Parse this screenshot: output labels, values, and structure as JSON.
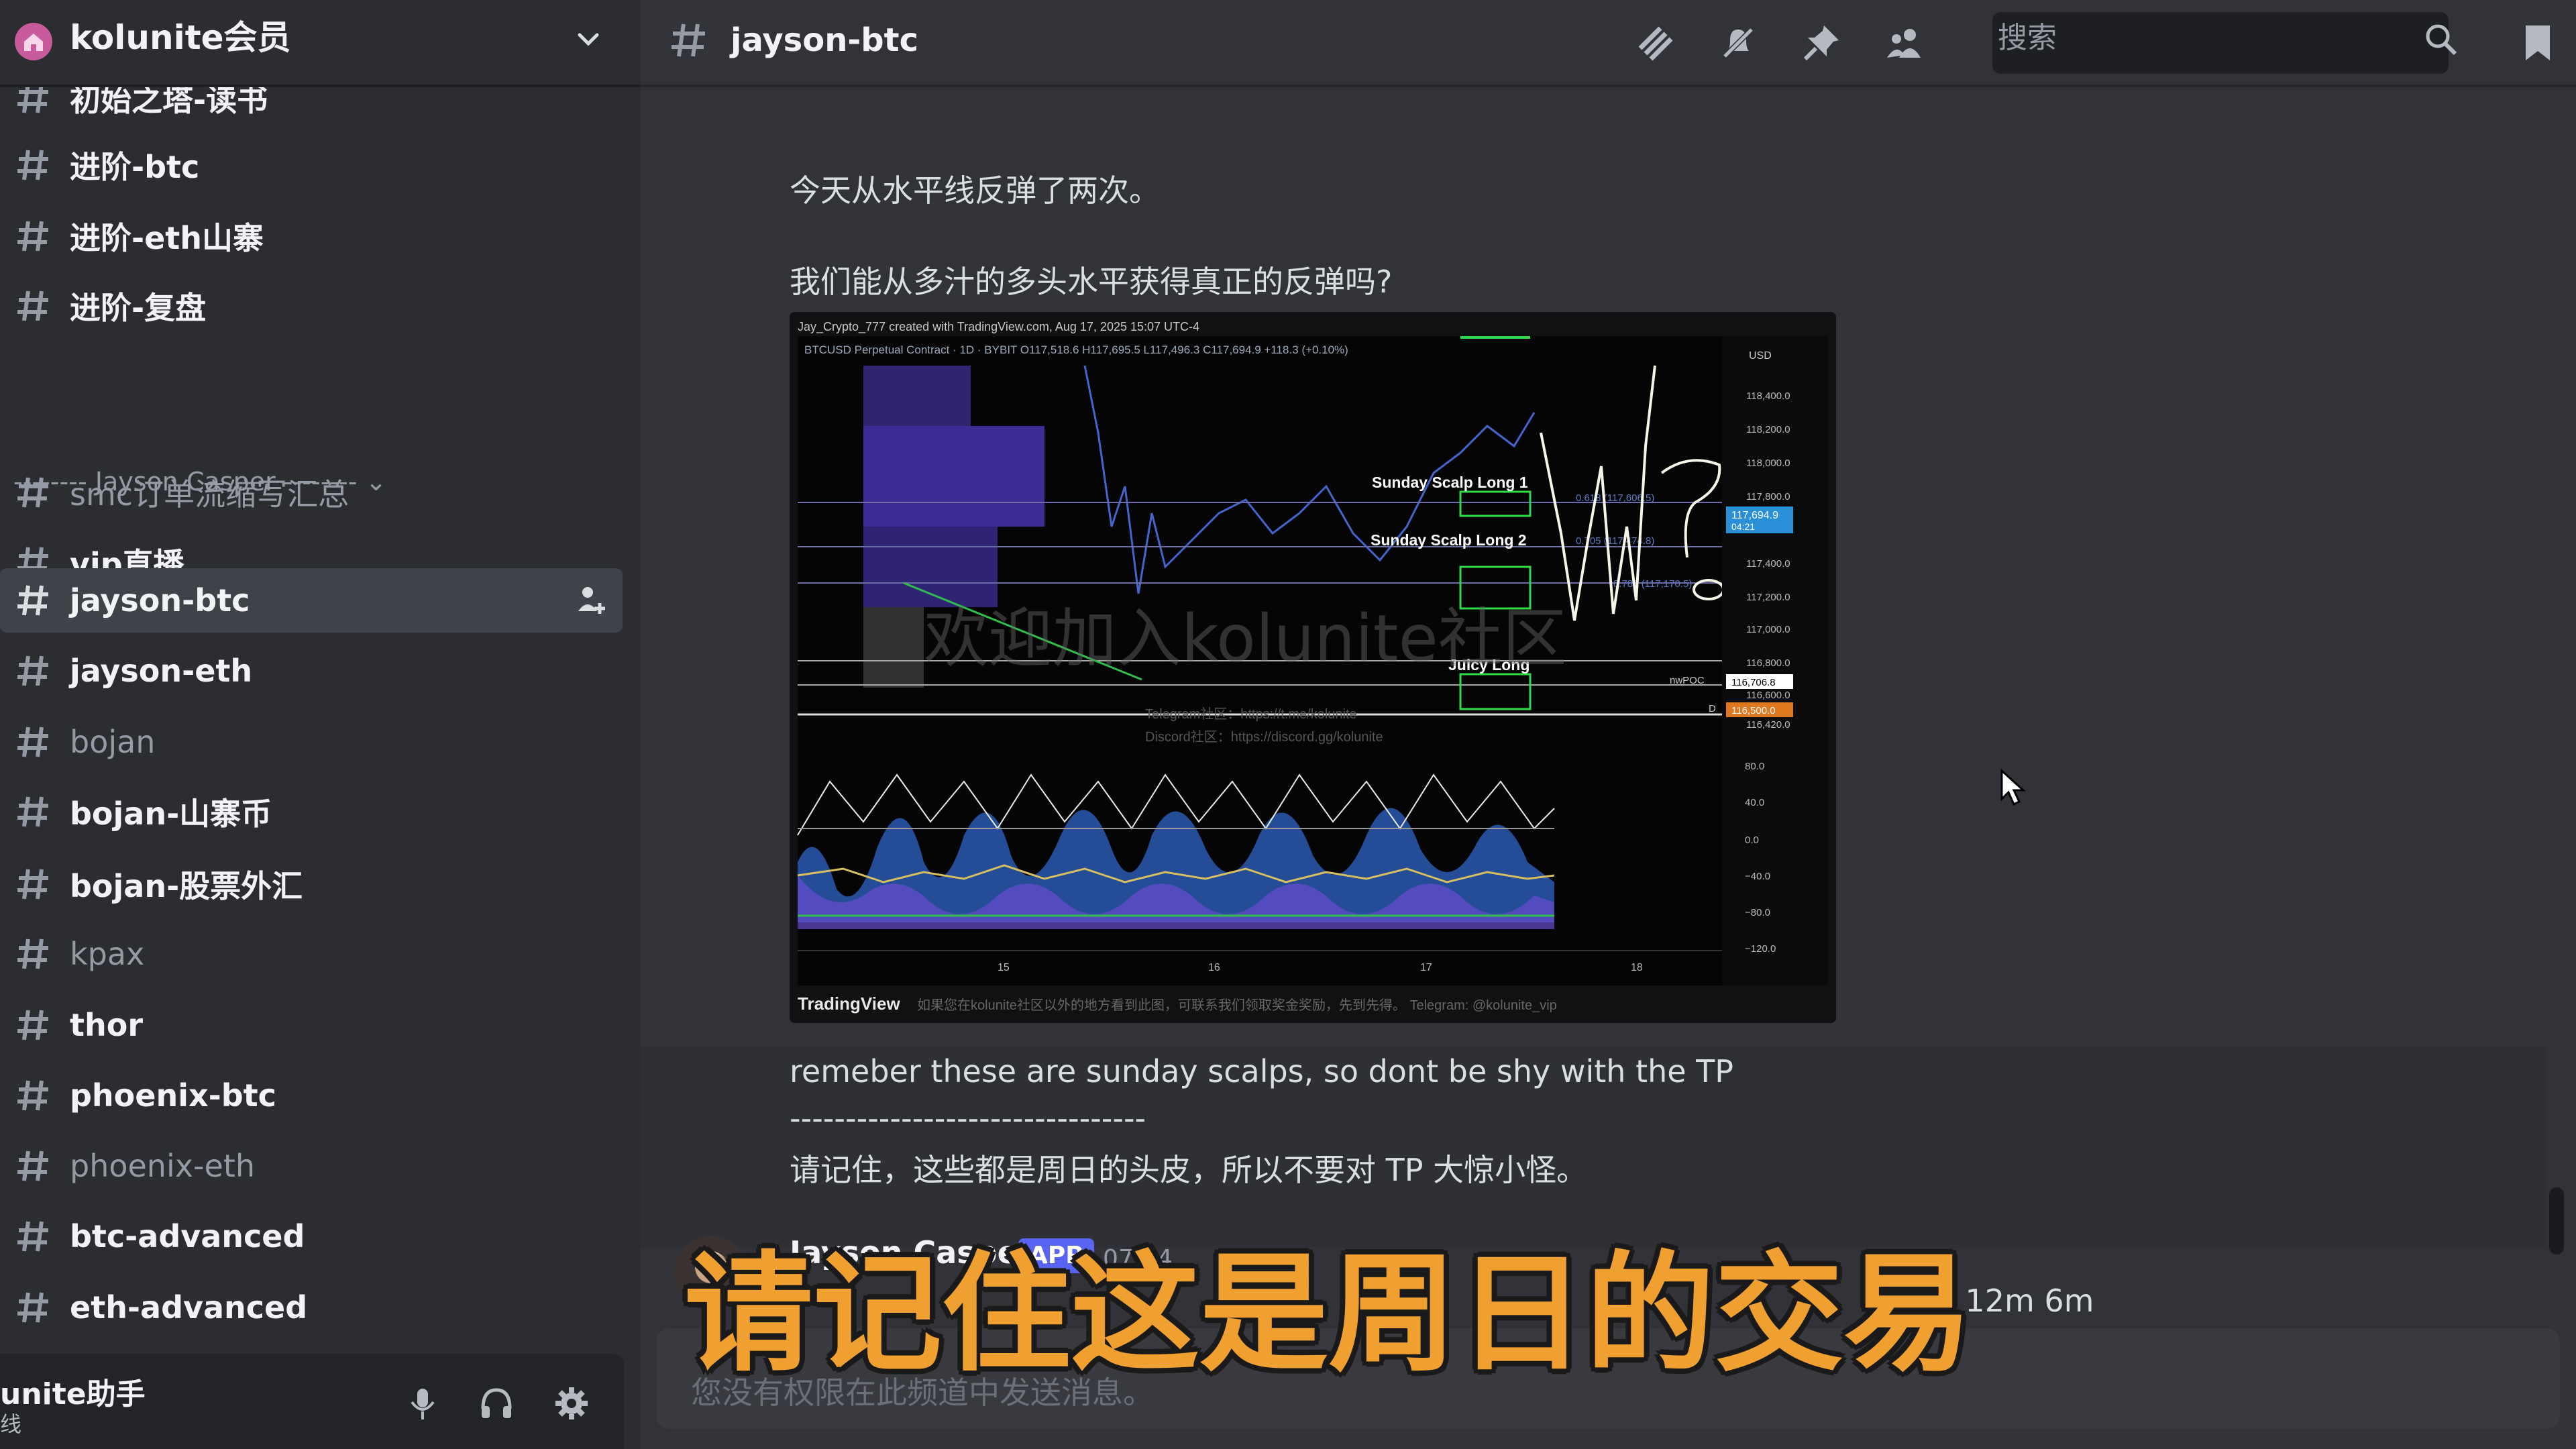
{
  "server": {
    "name": "kolunite会员"
  },
  "sidebar": {
    "channels_top": [
      {
        "label": "初始之塔-读书",
        "muted": false
      },
      {
        "label": "进阶-btc",
        "muted": false
      },
      {
        "label": "进阶-eth山寨",
        "muted": false
      },
      {
        "label": "进阶-复盘",
        "muted": false
      }
    ],
    "category": "-------- Jayson Casper --------",
    "channels": [
      {
        "label": "smc订单流缩写汇总",
        "muted": true
      },
      {
        "label": "vip直播",
        "muted": false
      },
      {
        "label": "jayson-btc",
        "muted": false,
        "active": true
      },
      {
        "label": "jayson-eth",
        "muted": false
      },
      {
        "label": "bojan",
        "muted": true
      },
      {
        "label": "bojan-山寨币",
        "muted": false
      },
      {
        "label": "bojan-股票外汇",
        "muted": false
      },
      {
        "label": "kpax",
        "muted": true
      },
      {
        "label": "thor",
        "muted": false
      },
      {
        "label": "phoenix-btc",
        "muted": false
      },
      {
        "label": "phoenix-eth",
        "muted": true
      },
      {
        "label": "btc-advanced",
        "muted": false
      },
      {
        "label": "eth-advanced",
        "muted": false
      }
    ]
  },
  "user_panel": {
    "name": "unite助手",
    "status": "线"
  },
  "topbar": {
    "channel": "jayson-btc",
    "search_placeholder": "搜索"
  },
  "messages": {
    "line1": "今天从水平线反弹了两次。",
    "line2": "我们能从多汁的多头水平获得真正的反弹吗?",
    "line3": "remeber these are sunday scalps, so dont be shy with the TP",
    "divider": "--------------------------------",
    "line4": "请记住，这些都是周日的头皮，所以不要对 TP 大惊小怪。",
    "author": {
      "name": "Jayson Casper",
      "badge": "APP",
      "time": "07:24",
      "preview": "m 12m 6m"
    }
  },
  "chart": {
    "header": "Jay_Crypto_777 created with TradingView.com, Aug 17, 2025 15:07 UTC-4",
    "symbol": "BTCUSD Perpetual Contract · 1D · BYBIT  O117,518.6  H117,695.5  L117,496.3  C117,694.9  +118.3 (+0.10%)",
    "watermark": "欢迎加入kolunite社区",
    "labels": [
      "Sunday Scalp Long 1",
      "Sunday Scalp Long 2",
      "Juicy Long"
    ],
    "fib_labels": [
      "0.618 (117,606.5)",
      "0.705 (117,474.8)",
      "0.786 (117,170.5)"
    ],
    "currency": "USD",
    "price_ticks": [
      "118,400.0",
      "118,200.0",
      "118,000.0",
      "117,800.0",
      "117,400.0",
      "117,200.0",
      "117,000.0",
      "116,800.0",
      "116,600.0",
      "116,420.0"
    ],
    "price_badge": "117,694.9",
    "price_badge_sub": "04:21",
    "npoc_label": "nwPOC",
    "npoc_value": "116,706.8",
    "d_label": "D",
    "d_value": "116,500.0",
    "osc_ticks": [
      "80.0",
      "40.0",
      "0.0",
      "−40.0",
      "−80.0",
      "−120.0"
    ],
    "x_ticks": [
      "15",
      "16",
      "17",
      "18"
    ],
    "footer_logo": "TradingView",
    "footer_note": "如果您在kolunite社区以外的地方看到此图，可联系我们领取奖金奖励，先到先得。  Telegram: @kolunite_vip",
    "telegram_line": "Telegram社区：https://t.me/kolunite",
    "discord_line": "Discord社区：https://discord.gg/kolunite"
  },
  "composer": {
    "placeholder": "您没有权限在此频道中发送消息。"
  },
  "caption": "请记住这是周日的交易",
  "colors": {
    "sidebar": "#2b2d31",
    "main": "#313338",
    "accent": "#5865f2",
    "caption": "#f0a030"
  }
}
